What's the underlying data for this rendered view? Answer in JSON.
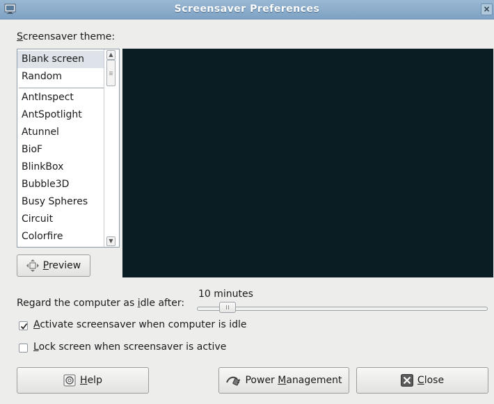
{
  "window": {
    "title": "Screensaver Preferences",
    "close_glyph": "×"
  },
  "theme_label": "Screensaver theme:",
  "themes": [
    "Blank screen",
    "Random",
    "AntInspect",
    "AntSpotlight",
    "Atunnel",
    "BioF",
    "BlinkBox",
    "Bubble3D",
    "Busy Spheres",
    "Circuit",
    "Colorfire"
  ],
  "selected_theme": "Blank screen",
  "preview_button": "Preview",
  "idle": {
    "label": "Regard the computer as idle after:",
    "value_text": "10 minutes",
    "fraction": 0.08
  },
  "activate_checkbox": {
    "label": "Activate screensaver when computer is idle",
    "checked": true
  },
  "lock_checkbox": {
    "label": "Lock screen when screensaver is active",
    "checked": false
  },
  "buttons": {
    "help": "Help",
    "power": "Power Management",
    "close": "Close"
  },
  "colors": {
    "preview_bg": "#0a1d22",
    "titlebar": "#8fb0cf"
  }
}
